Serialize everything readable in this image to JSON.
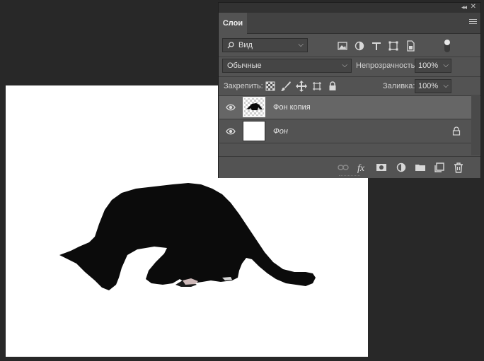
{
  "panel": {
    "tab_label": "Слои",
    "filter_kind": "Вид",
    "blend_mode": "Обычные",
    "opacity_label": "Непрозрачность:",
    "opacity_value": "100%",
    "lock_label": "Закрепить:",
    "fill_label": "Заливка:",
    "fill_value": "100%"
  },
  "layers": [
    {
      "name": "Фон копия",
      "visible": true,
      "selected": true,
      "locked": false
    },
    {
      "name": "Фон",
      "visible": true,
      "selected": false,
      "locked": true
    }
  ],
  "colors": {
    "workspace": "#282828",
    "panel": "#535353",
    "selected_layer": "#666666",
    "cat": "#0a0a0a"
  },
  "icons": {
    "filter_icons": [
      "image-filter-icon",
      "adjustment-filter-icon",
      "type-filter-icon",
      "shape-filter-icon",
      "smart-object-filter-icon",
      "filter-toggle-icon"
    ],
    "lock_icons": [
      "lock-transparent-icon",
      "lock-brush-icon",
      "lock-move-icon",
      "lock-artboard-icon",
      "lock-all-icon"
    ],
    "bottom_icons": [
      "link-icon",
      "fx-icon",
      "mask-icon",
      "adjustment-icon",
      "folder-icon",
      "new-layer-icon",
      "trash-icon"
    ]
  }
}
